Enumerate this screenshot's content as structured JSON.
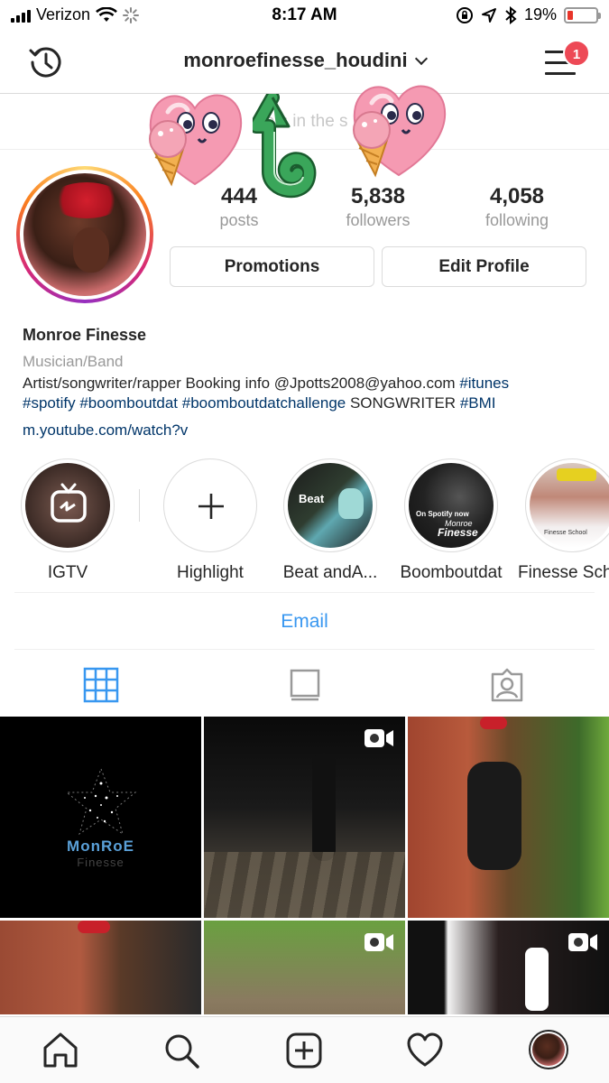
{
  "status_bar": {
    "carrier": "Verizon",
    "time": "8:17 AM",
    "battery": "19%"
  },
  "header": {
    "username": "monroefinesse_houdini",
    "notification_count": "1"
  },
  "banner": {
    "text": "le        s in the        s"
  },
  "profile": {
    "stats": [
      {
        "num": "444",
        "label": "posts"
      },
      {
        "num": "5,838",
        "label": "followers"
      },
      {
        "num": "4,058",
        "label": "following"
      }
    ],
    "promotions_label": "Promotions",
    "edit_profile_label": "Edit Profile",
    "name": "Monroe Finesse",
    "category": "Musician/Band",
    "bio_plain_1": "Artist/songwriter/rapper Booking info @Jpotts2008@yahoo.com ",
    "bio_tag_1": "#itunes",
    "bio_tag_2": "#spotify",
    "bio_tag_3": "#boomboutdat",
    "bio_tag_4": "#boomboutdatchallenge",
    "bio_plain_2": " SONGWRITER ",
    "bio_tag_5": "#BMI",
    "link": "m.youtube.com/watch?v"
  },
  "highlights": [
    {
      "label": "IGTV"
    },
    {
      "label": "Highlight"
    },
    {
      "label": "Beat andA..."
    },
    {
      "label": "Boomboutdat"
    },
    {
      "label": "Finesse Sch"
    }
  ],
  "highlight_thumbs": {
    "beat_text": "Beat",
    "spotify_text": "On Spotify now",
    "monroe_text": "Monroe",
    "finesse_text": "Finesse",
    "school_text": "Finesse School"
  },
  "email_label": "Email",
  "grid": {
    "logo_main": "MonRoE",
    "logo_sub": "Finesse"
  },
  "colors": {
    "accent": "#3897f0",
    "badge": "#ed4956",
    "link": "#003569"
  }
}
